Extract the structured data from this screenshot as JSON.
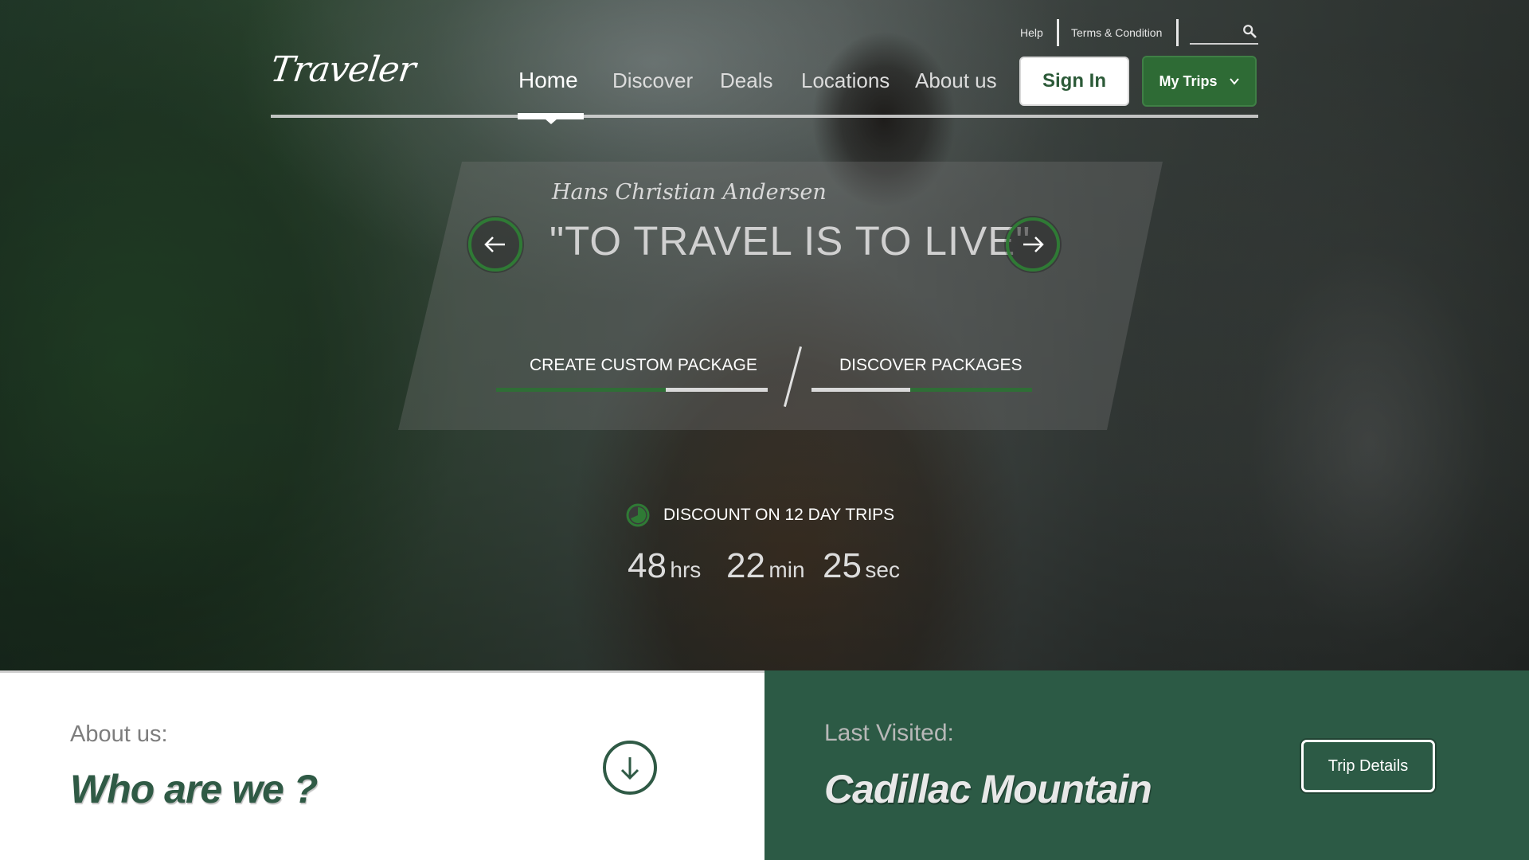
{
  "colors": {
    "brand_green": "#2f6e36",
    "section_green": "#2c5a45",
    "white": "#ffffff"
  },
  "utility": {
    "help_label": "Help",
    "terms_label": "Terms & Condition",
    "search_placeholder": "",
    "search_icon": "search-icon"
  },
  "header": {
    "logo": "Traveler",
    "nav": [
      {
        "label": "Home",
        "active": true
      },
      {
        "label": "Discover",
        "active": false
      },
      {
        "label": "Deals",
        "active": false
      },
      {
        "label": "Locations",
        "active": false
      },
      {
        "label": "About us",
        "active": false
      }
    ],
    "signin_label": "Sign In",
    "mytrips_label": "My Trips"
  },
  "hero": {
    "author": "Hans Christian Andersen",
    "quote": "\"TO TRAVEL IS TO LIVE\"",
    "cta_custom": "CREATE CUSTOM PACKAGE",
    "cta_discover": "DISCOVER PACKAGES",
    "cta_custom_progress": 0.62,
    "cta_discover_progress": 0.45
  },
  "discount": {
    "label": "DISCOUNT ON 12 DAY TRIPS",
    "hours": "48",
    "hours_unit": "hrs",
    "minutes": "22",
    "minutes_unit": "min",
    "seconds": "25",
    "seconds_unit": "sec"
  },
  "about": {
    "label": "About us:",
    "title": "Who are we ?"
  },
  "last_visited": {
    "label": "Last Visited:",
    "title": "Cadillac Mountain",
    "button_label": "Trip Details"
  }
}
